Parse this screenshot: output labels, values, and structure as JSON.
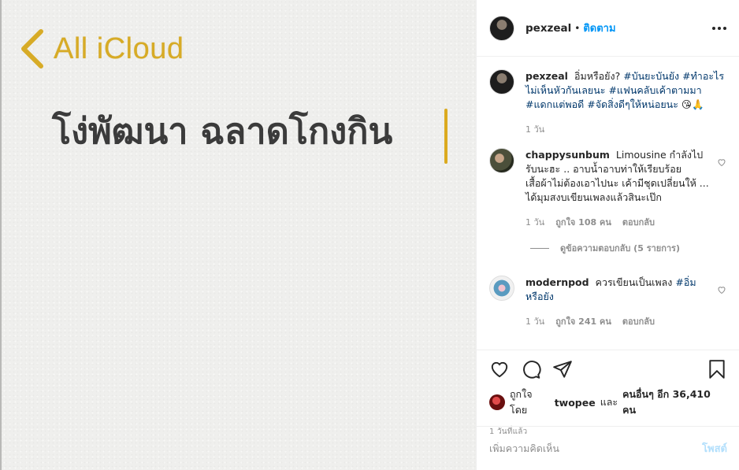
{
  "image": {
    "back_label": "All iCloud",
    "note_text": "โง่พัฒนา ฉลาดโกงกิน"
  },
  "header": {
    "username": "pexzeal",
    "separator": "•",
    "follow_label": "ติดตาม"
  },
  "caption": {
    "username": "pexzeal",
    "text_plain": "อิ่มหรือยัง?",
    "hashtags": "#บันยะบันยัง #ทำอะไรไม่เห็นหัวกันเลยนะ #แฟนคลับเค้าตามมา #แดกแต่พอดี #จัดสิ่งดีๆให้หน่อยนะ",
    "emoji": "😘🙏",
    "time": "1 วัน"
  },
  "comments": [
    {
      "username": "chappysunbum",
      "text": "Limousine กำลังไปรับนะฮะ .. อาบน้ำอาบท่าให้เรียบร้อย เสื้อผ้าไม่ต้องเอาไปนะ เค้ามีชุดเปลี่ยนให้ ... ได้มุมสงบเขียนเพลงแล้วสินะเป๊ก",
      "time": "1 วัน",
      "likes": "ถูกใจ 108 คน",
      "reply_label": "ตอบกลับ",
      "view_replies": "ดูข้อความตอบกลับ (5 รายการ)"
    },
    {
      "username": "modernpod",
      "text_plain": "ควรเขียนเป็นเพลง",
      "hashtag": "#อิ่มหรือยัง",
      "time": "1 วัน",
      "likes": "ถูกใจ 241 คน",
      "reply_label": "ตอบกลับ"
    }
  ],
  "likes": {
    "prefix": "ถูกใจโดย",
    "user": "twopee",
    "middle": "และ",
    "others": "คนอื่นๆ อีก 36,410 คน"
  },
  "time_ago": "1 วันที่แล้ว",
  "comment_box": {
    "placeholder": "เพิ่มความคิดเห็น",
    "post_label": "โพสต์"
  },
  "colors": {
    "accent_link": "#0095f6",
    "hashtag": "#00376b",
    "notes_gold": "#d7ab26"
  }
}
